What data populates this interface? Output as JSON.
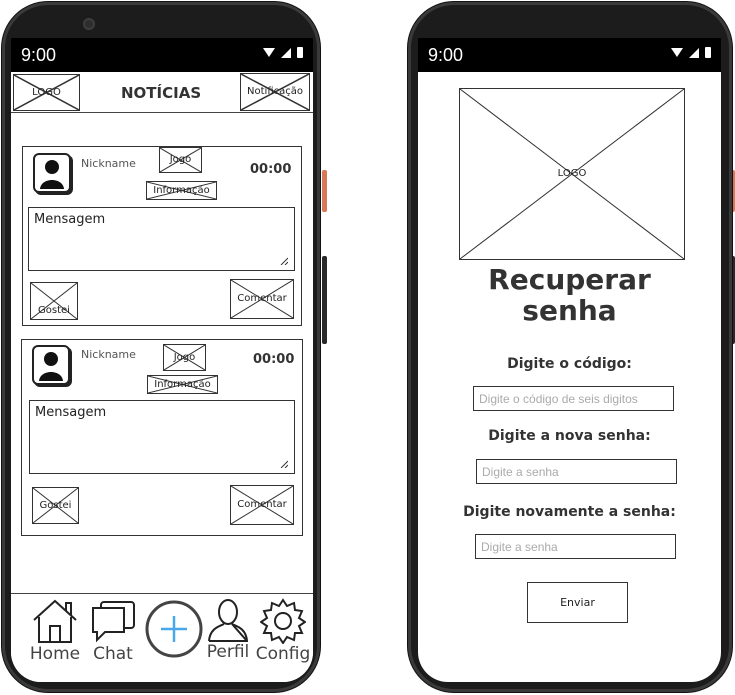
{
  "status": {
    "time": "9:00"
  },
  "feed": {
    "header": {
      "logo": "LOGO",
      "title": "NOTÍCIAS",
      "notification": "Notificação"
    },
    "posts": [
      {
        "nickname": "Nickname",
        "game": "Jogo",
        "info": "Informação",
        "time": "00:00",
        "message": "Mensagem",
        "like": "Gostei",
        "comment": "Comentar"
      },
      {
        "nickname": "Nickname",
        "game": "Jogo",
        "info": "Informação",
        "time": "00:00",
        "message": "Mensagem",
        "like": "Gostei",
        "comment": "Comentar"
      }
    ],
    "nav": {
      "home": "Home",
      "chat": "Chat",
      "profile": "Perfil",
      "config": "Config"
    },
    "icons": [
      "home-icon",
      "chat-icon",
      "add-icon",
      "profile-icon",
      "gear-icon"
    ],
    "accent": "#4aa8e8"
  },
  "recover": {
    "logo": "LOGO",
    "title_line1": "Recuperar",
    "title_line2": "senha",
    "code_label": "Digite o código:",
    "code_placeholder": "Digite o código de seis digitos",
    "new_label": "Digite a nova senha:",
    "new_placeholder": "Digite a senha",
    "repeat_label": "Digite novamente a senha:",
    "repeat_placeholder": "Digite a senha",
    "submit": "Enviar"
  }
}
